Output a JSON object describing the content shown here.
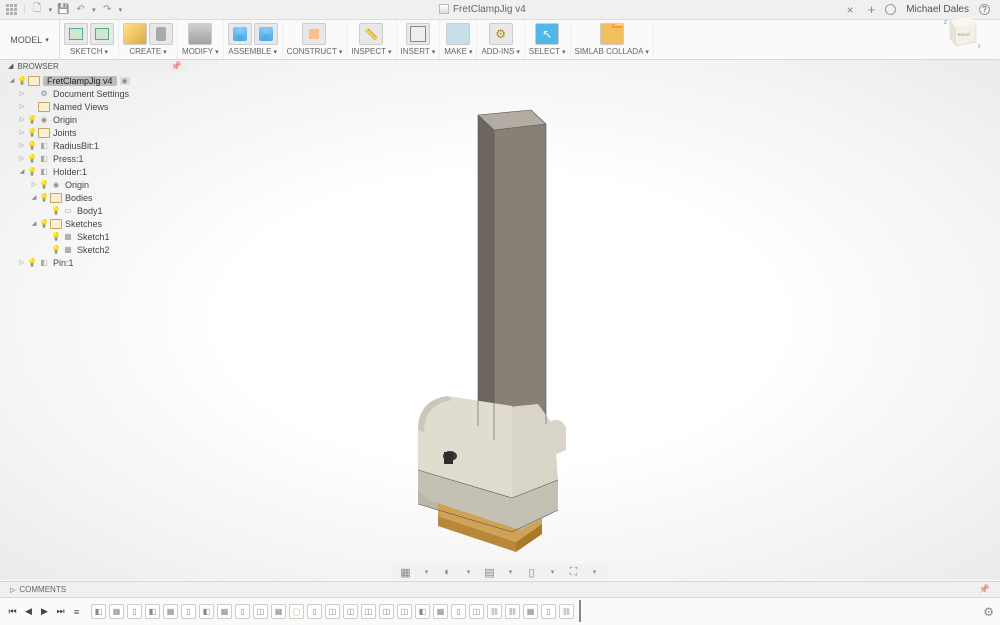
{
  "titlebar": {
    "doc_title": "FretClampJig v4",
    "user_name": "Michael Dales"
  },
  "ribbon": {
    "model_label": "MODEL",
    "groups": [
      {
        "label": "SKETCH",
        "caret": true,
        "icons": 2,
        "cls": [
          "ic-sketch",
          "ic-sketch"
        ]
      },
      {
        "label": "CREATE",
        "caret": true,
        "icons": 2,
        "cls": [
          "ic-box",
          "ic-cyl"
        ]
      },
      {
        "label": "MODIFY",
        "caret": true,
        "icons": 1,
        "cls": [
          "ic-modify"
        ]
      },
      {
        "label": "ASSEMBLE",
        "caret": true,
        "icons": 2,
        "cls": [
          "ic-assemble",
          "ic-assemble"
        ]
      },
      {
        "label": "CONSTRUCT",
        "caret": true,
        "icons": 1,
        "cls": [
          "ic-construct"
        ]
      },
      {
        "label": "INSPECT",
        "caret": true,
        "icons": 1,
        "cls": [
          "ic-inspect"
        ]
      },
      {
        "label": "INSERT",
        "caret": true,
        "icons": 1,
        "cls": [
          "ic-insert"
        ]
      },
      {
        "label": "MAKE",
        "caret": true,
        "icons": 1,
        "cls": [
          "ic-make"
        ]
      },
      {
        "label": "ADD-INS",
        "caret": true,
        "icons": 1,
        "cls": [
          "ic-addins"
        ]
      },
      {
        "label": "SELECT",
        "caret": true,
        "icons": 1,
        "cls": [
          "ic-select"
        ]
      },
      {
        "label": "SIMLAB COLLADA",
        "caret": true,
        "icons": 1,
        "cls": [
          "ic-simlab"
        ]
      }
    ]
  },
  "browser": {
    "header": "BROWSER",
    "root": "FretClampJig v4",
    "items": [
      {
        "exp": "closed",
        "ind": 1,
        "bulb": "",
        "icon": "fi-gear",
        "label": "Document Settings"
      },
      {
        "exp": "closed",
        "ind": 1,
        "bulb": "",
        "icon": "fi-folder",
        "label": "Named Views"
      },
      {
        "exp": "closed",
        "ind": 1,
        "bulb": "on",
        "icon": "fi-origin",
        "label": "Origin"
      },
      {
        "exp": "closed",
        "ind": 1,
        "bulb": "on",
        "icon": "fi-folder",
        "label": "Joints"
      },
      {
        "exp": "closed",
        "ind": 1,
        "bulb": "on",
        "icon": "fi-comp",
        "label": "RadiusBit:1"
      },
      {
        "exp": "closed",
        "ind": 1,
        "bulb": "on",
        "icon": "fi-comp",
        "label": "Press:1"
      },
      {
        "exp": "open",
        "ind": 1,
        "bulb": "on",
        "icon": "fi-comp",
        "label": "Holder:1"
      },
      {
        "exp": "closed",
        "ind": 2,
        "bulb": "on",
        "icon": "fi-origin",
        "label": "Origin"
      },
      {
        "exp": "open",
        "ind": 2,
        "bulb": "on",
        "icon": "fi-folder",
        "label": "Bodies"
      },
      {
        "exp": "none",
        "ind": 3,
        "bulb": "on",
        "icon": "fi-body",
        "label": "Body1"
      },
      {
        "exp": "open",
        "ind": 2,
        "bulb": "on",
        "icon": "fi-folder",
        "label": "Sketches"
      },
      {
        "exp": "none",
        "ind": 3,
        "bulb": "on",
        "icon": "fi-sketch",
        "label": "Sketch1"
      },
      {
        "exp": "none",
        "ind": 3,
        "bulb": "on",
        "icon": "fi-sketch",
        "label": "Sketch2"
      },
      {
        "exp": "closed",
        "ind": 1,
        "bulb": "on",
        "icon": "fi-comp",
        "label": "Pin:1"
      }
    ]
  },
  "viewcube": {
    "face": "RIGHT",
    "axes": [
      "Z",
      "X"
    ]
  },
  "comments": {
    "label": "COMMENTS"
  },
  "timeline": {
    "items": [
      "tl-comp",
      "tl-sk",
      "tl-ext",
      "tl-comp",
      "tl-sk",
      "tl-ext",
      "tl-comp",
      "tl-sk",
      "tl-ext",
      "tl-cut",
      "tl-sk",
      "tl-cir",
      "tl-ext",
      "tl-cut",
      "tl-cut",
      "tl-cut",
      "tl-cut",
      "tl-cut",
      "tl-comp",
      "tl-sk",
      "tl-ext",
      "tl-cut",
      "tl-joint",
      "tl-joint",
      "tl-sk",
      "tl-ext",
      "tl-joint"
    ]
  }
}
